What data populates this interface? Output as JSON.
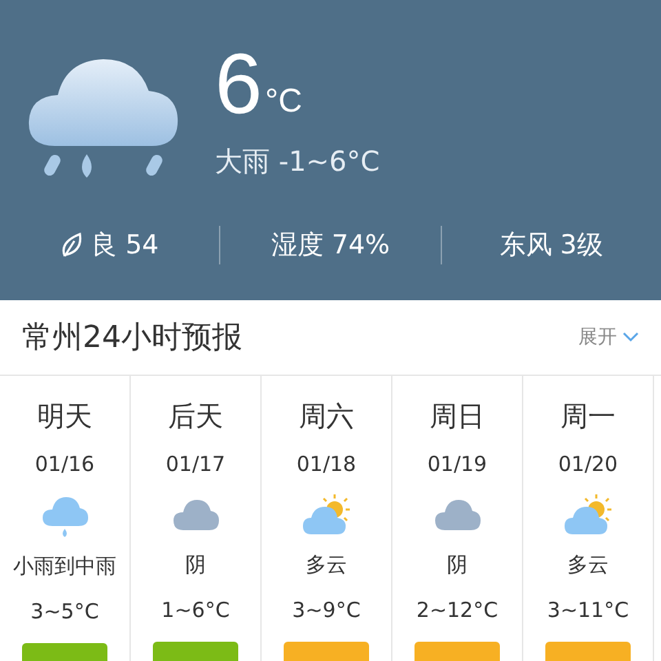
{
  "current": {
    "temp": "6",
    "unit": "°C",
    "summary": "大雨 -1~6°C"
  },
  "stats": [
    {
      "kind": "air",
      "text": "良 54"
    },
    {
      "kind": "plain",
      "text": "湿度 74%"
    },
    {
      "kind": "plain",
      "text": "东风 3级"
    }
  ],
  "forecast": {
    "title": "常州24小时预报",
    "expand": "展开",
    "days": [
      {
        "day": "明天",
        "date": "01/16",
        "kind": "rain",
        "condition": "小雨到中雨",
        "range": "3~5°C",
        "color": "#7cbb16"
      },
      {
        "day": "后天",
        "date": "01/17",
        "kind": "overcast",
        "condition": "阴",
        "range": "1~6°C",
        "color": "#7cbb16"
      },
      {
        "day": "周六",
        "date": "01/18",
        "kind": "partly",
        "condition": "多云",
        "range": "3~9°C",
        "color": "#f7b023"
      },
      {
        "day": "周日",
        "date": "01/19",
        "kind": "overcast",
        "condition": "阴",
        "range": "2~12°C",
        "color": "#f7b023"
      },
      {
        "day": "周一",
        "date": "01/20",
        "kind": "partly",
        "condition": "多云",
        "range": "3~11°C",
        "color": "#f7b023"
      }
    ]
  }
}
